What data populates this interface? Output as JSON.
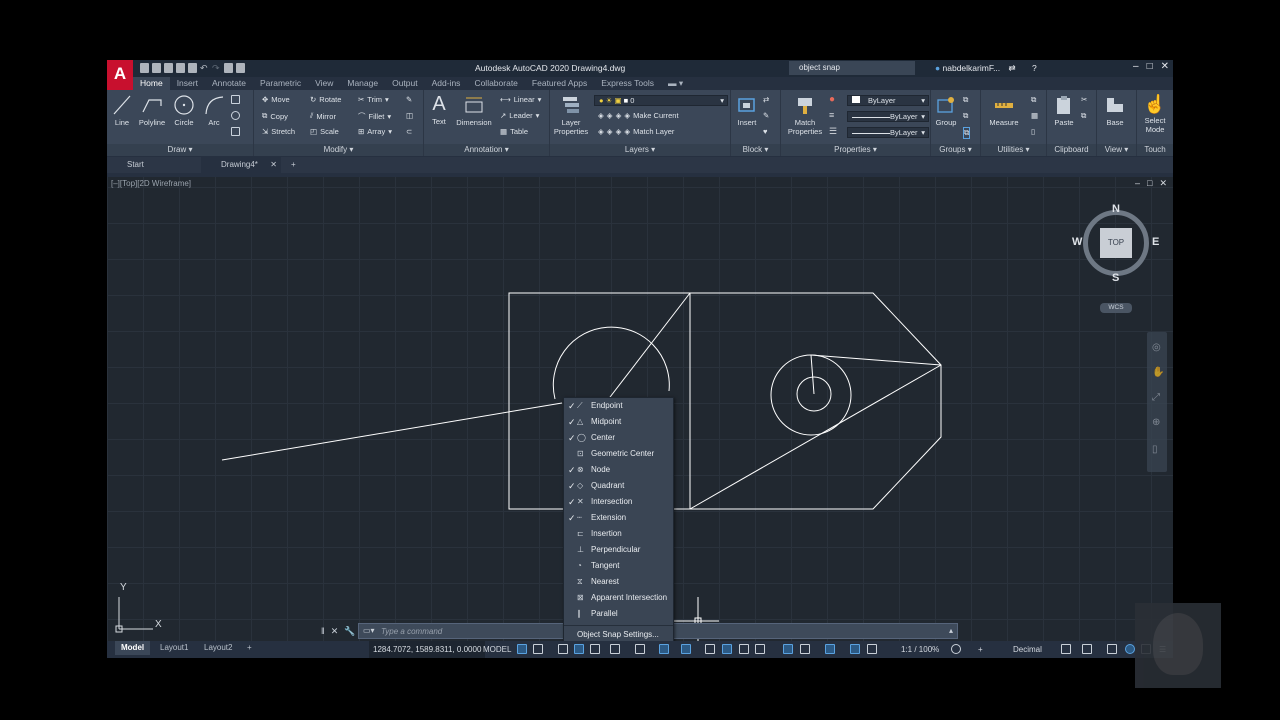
{
  "window": {
    "app_title": "Autodesk AutoCAD 2020   Drawing4.dwg",
    "logo": "A",
    "search_value": "object snap",
    "user": "nabdelkarimF...",
    "controls": [
      "–",
      "□",
      "✕"
    ]
  },
  "ribbon_tabs": [
    "Home",
    "Insert",
    "Annotate",
    "Parametric",
    "View",
    "Manage",
    "Output",
    "Add-ins",
    "Collaborate",
    "Featured Apps",
    "Express Tools"
  ],
  "panels": {
    "draw": {
      "title": "Draw ▾",
      "line": "Line",
      "polyline": "Polyline",
      "circle": "Circle",
      "arc": "Arc"
    },
    "modify": {
      "title": "Modify ▾",
      "move": "Move",
      "rotate": "Rotate",
      "trim": "Trim",
      "copy": "Copy",
      "mirror": "Mirror",
      "fillet": "Fillet",
      "stretch": "Stretch",
      "scale": "Scale",
      "array": "Array"
    },
    "annotation": {
      "title": "Annotation ▾",
      "text": "Text",
      "dimension": "Dimension",
      "linear": "Linear",
      "leader": "Leader",
      "table": "Table"
    },
    "layers": {
      "title": "Layers ▾",
      "layer_properties": "Layer\nProperties",
      "layer_value": "0",
      "make_current": "Make Current",
      "match_layer": "Match Layer"
    },
    "block": {
      "title": "Block ▾",
      "insert": "Insert"
    },
    "properties": {
      "title": "Properties ▾",
      "match_properties": "Match\nProperties",
      "color": "ByLayer",
      "linetype": "ByLayer",
      "lineweight": "ByLayer"
    },
    "groups": {
      "title": "Groups ▾",
      "group": "Group"
    },
    "utilities": {
      "title": "Utilities ▾",
      "measure": "Measure"
    },
    "clipboard": {
      "title": "Clipboard",
      "paste": "Paste"
    },
    "view": {
      "title": "View ▾",
      "base": "Base"
    },
    "touch": {
      "title": "Touch",
      "select_mode": "Select\nMode"
    }
  },
  "file_tabs": {
    "start": "Start",
    "drawing": "Drawing4*",
    "close": "✕",
    "add": "+"
  },
  "viewport": {
    "label": "[–][Top][2D Wireframe]",
    "controls": [
      "–",
      "□",
      "✕"
    ],
    "viewcube": {
      "n": "N",
      "s": "S",
      "e": "E",
      "w": "W",
      "face": "TOP",
      "wcs": "WCS"
    },
    "ucs": {
      "x": "X",
      "y": "Y"
    }
  },
  "snap_menu": {
    "items": [
      {
        "label": "Endpoint",
        "checked": true,
        "icon": "endpoint-icon"
      },
      {
        "label": "Midpoint",
        "checked": true,
        "icon": "midpoint-icon"
      },
      {
        "label": "Center",
        "checked": true,
        "icon": "center-icon"
      },
      {
        "label": "Geometric Center",
        "checked": false,
        "icon": "geometric-center-icon"
      },
      {
        "label": "Node",
        "checked": true,
        "icon": "node-icon"
      },
      {
        "label": "Quadrant",
        "checked": true,
        "icon": "quadrant-icon"
      },
      {
        "label": "Intersection",
        "checked": true,
        "icon": "intersection-icon"
      },
      {
        "label": "Extension",
        "checked": true,
        "icon": "extension-icon"
      },
      {
        "label": "Insertion",
        "checked": false,
        "icon": "insertion-icon"
      },
      {
        "label": "Perpendicular",
        "checked": false,
        "icon": "perpendicular-icon"
      },
      {
        "label": "Tangent",
        "checked": false,
        "icon": "tangent-icon"
      },
      {
        "label": "Nearest",
        "checked": false,
        "icon": "nearest-icon"
      },
      {
        "label": "Apparent Intersection",
        "checked": false,
        "icon": "apparent-intersection-icon"
      },
      {
        "label": "Parallel",
        "checked": false,
        "icon": "parallel-icon"
      }
    ],
    "settings": "Object Snap Settings..."
  },
  "command_line": {
    "placeholder": "Type a command"
  },
  "status": {
    "layouts": [
      "Model",
      "Layout1",
      "Layout2"
    ],
    "coords": "1284.7072, 1589.8311, 0.0000",
    "model": "MODEL",
    "scale": "1:1 / 100%",
    "units": "Decimal"
  },
  "colors": {
    "accent": "#5aa2e0",
    "logo": "#c8102e",
    "geometry": "#ffffff"
  }
}
